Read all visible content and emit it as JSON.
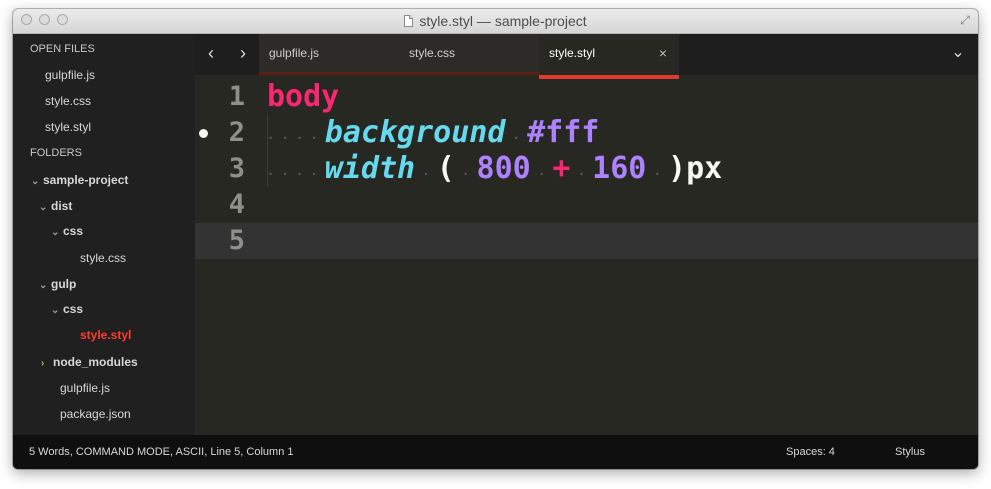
{
  "window": {
    "title": "style.styl — sample-project"
  },
  "sidebar": {
    "open_files_heading": "OPEN FILES",
    "open_files": [
      "gulpfile.js",
      "style.css",
      "style.styl"
    ],
    "folders_heading": "FOLDERS",
    "tree": {
      "root": "sample-project",
      "dist": "dist",
      "dist_css": "css",
      "dist_css_file": "style.css",
      "gulp": "gulp",
      "gulp_css": "css",
      "gulp_css_file": "style.styl",
      "node_modules": "node_modules",
      "gulpfile": "gulpfile.js",
      "package": "package.json"
    }
  },
  "tabs": [
    {
      "label": "gulpfile.js",
      "active": false
    },
    {
      "label": "style.css",
      "active": false
    },
    {
      "label": "style.styl",
      "active": true
    }
  ],
  "icons": {
    "back": "chevron-left-icon",
    "forward": "chevron-right-icon",
    "menu": "chevron-down-icon",
    "close": "close-icon",
    "fullscreen": "fullscreen-icon"
  },
  "editor": {
    "line_numbers": [
      "1",
      "2",
      "3",
      "4",
      "5"
    ],
    "modified_line": 2,
    "current_line": 5,
    "code": {
      "l1_selector": "body",
      "l2_prop": "background",
      "l2_value": "#fff",
      "l3_prop": "width",
      "l3_paren_open": "(",
      "l3_num1": "800",
      "l3_op": "+",
      "l3_num2": "160",
      "l3_tail": ")px"
    }
  },
  "status": {
    "left": "5 Words, COMMAND MODE, ASCII, Line 5, Column 1",
    "spaces": "Spaces: 4",
    "syntax": "Stylus"
  },
  "colors": {
    "background": "#272822",
    "sidebar": "#202020",
    "accent_tab": "#e03a2c",
    "keyword": "#f92672",
    "property": "#66d9ef",
    "number": "#ae81ff",
    "active_file": "#ff3b2f"
  }
}
